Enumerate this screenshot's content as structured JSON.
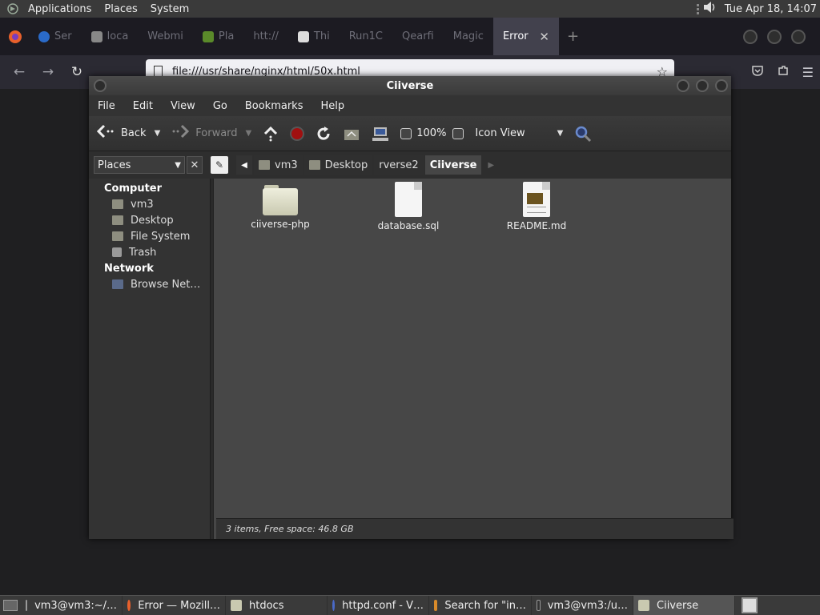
{
  "top_panel": {
    "menus": [
      "Applications",
      "Places",
      "System"
    ],
    "clock": "Tue Apr 18, 14:07"
  },
  "firefox": {
    "tabs": [
      "Ser",
      "loca",
      "Webmi",
      "Pla",
      "htt://",
      "Thi",
      "Run1C",
      "Qearfi",
      "Magic"
    ],
    "active_tab": "Error",
    "active_tab_close": "✕",
    "new_tab": "+",
    "url": "file:///usr/share/nginx/html/50x.html"
  },
  "caja": {
    "title": "Ciiverse",
    "menus": [
      "File",
      "Edit",
      "View",
      "Go",
      "Bookmarks",
      "Help"
    ],
    "toolbar": {
      "back": "Back",
      "forward": "Forward",
      "zoom": "100%",
      "view_mode": "Icon View"
    },
    "location": {
      "places_label": "Places",
      "close": "✕",
      "crumbs": [
        "vm3",
        "Desktop",
        "rverse2"
      ],
      "current": "Ciiverse"
    },
    "sidebar": {
      "sections": [
        {
          "heading": "Computer",
          "items": [
            "vm3",
            "Desktop",
            "File System",
            "Trash"
          ]
        },
        {
          "heading": "Network",
          "items": [
            "Browse Net…"
          ]
        }
      ]
    },
    "files": [
      {
        "name": "ciiverse-php",
        "kind": "folder"
      },
      {
        "name": "database.sql",
        "kind": "file"
      },
      {
        "name": "README.md",
        "kind": "doc"
      }
    ],
    "status": "3 items, Free space: 46.8 GB"
  },
  "taskbar": {
    "tasks": [
      "vm3@vm3:~/…",
      "Error — Mozill…",
      "htdocs",
      "httpd.conf - V…",
      "Search for \"in…",
      "vm3@vm3:/u…",
      "Ciiverse"
    ],
    "active_task": "Ciiverse"
  }
}
